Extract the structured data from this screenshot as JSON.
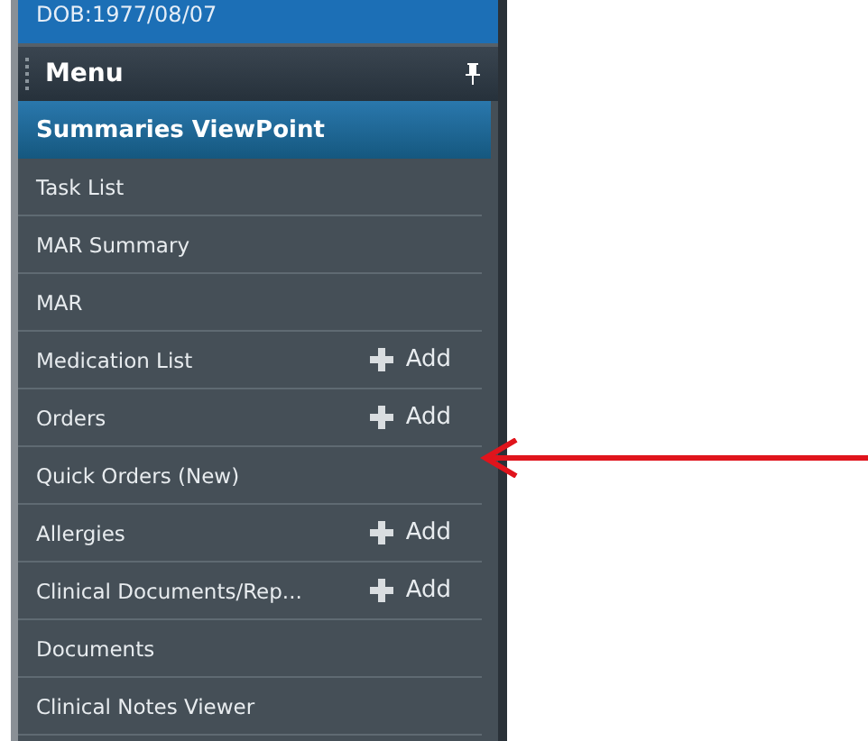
{
  "patient_banner": {
    "dob": "DOB:1977/08/07"
  },
  "menu": {
    "title": "Menu",
    "items": [
      {
        "label": "Summaries ViewPoint",
        "selected": true
      },
      {
        "label": "Task List",
        "selected": false
      },
      {
        "label": "MAR Summary",
        "selected": false
      },
      {
        "label": "MAR",
        "selected": false
      },
      {
        "label": "Medication List",
        "selected": false,
        "action": "Add"
      },
      {
        "label": "Orders",
        "selected": false,
        "action": "Add"
      },
      {
        "label": "Quick Orders (New)",
        "selected": false
      },
      {
        "label": "Allergies",
        "selected": false,
        "action": "Add"
      },
      {
        "label": "Clinical Documents/Rep...",
        "selected": false,
        "action": "Add"
      },
      {
        "label": "Documents",
        "selected": false
      },
      {
        "label": "Clinical Notes Viewer",
        "selected": false
      }
    ]
  }
}
